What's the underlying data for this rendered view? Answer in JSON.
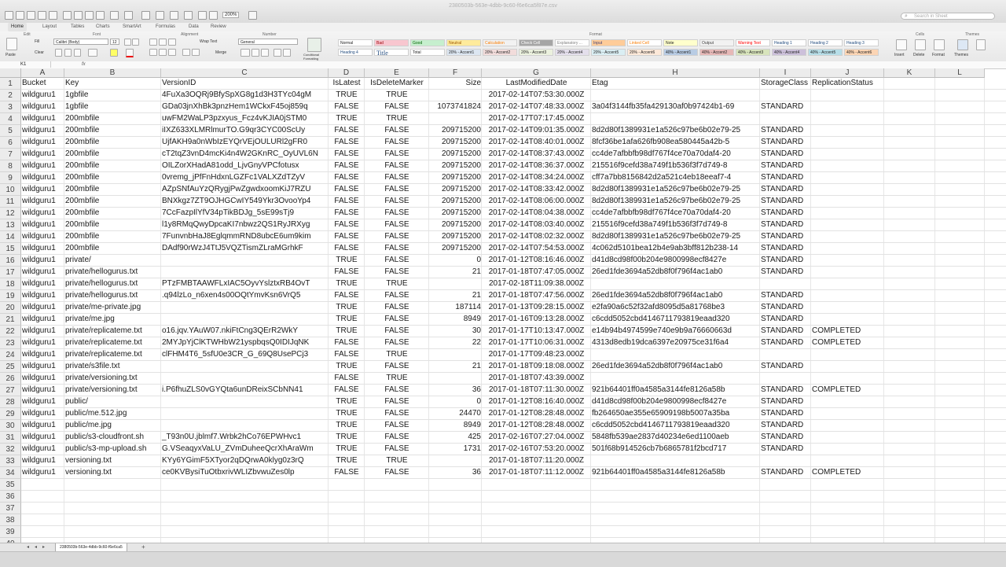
{
  "window": {
    "title": "2380503b-563e-4dbb-9c60-f6e6ca5f87e.csv",
    "zoom": "200%",
    "search_placeholder": "Search in Sheet"
  },
  "ribbon": {
    "tabs": [
      "Home",
      "Layout",
      "Tables",
      "Charts",
      "SmartArt",
      "Formulas",
      "Data",
      "Review"
    ],
    "groups": {
      "edit": "Edit",
      "font": "Font",
      "alignment": "Alignment",
      "number": "Number",
      "format": "Format",
      "cells": "Cells",
      "themes": "Themes"
    },
    "paste": "Paste",
    "fill": "Fill",
    "clear": "Clear",
    "font_name": "Calibri (Body)",
    "font_size": "12",
    "wrap_text": "Wrap Text",
    "merge": "Merge",
    "number_format": "General",
    "conditional": "Conditional Formatting",
    "insert": "Insert",
    "delete": "Delete",
    "format_btn": "Format",
    "themes_btn": "Themes",
    "styles": [
      {
        "label": "Normal",
        "bg": "#ffffff",
        "fg": "#222"
      },
      {
        "label": "Bad",
        "bg": "#f8c6cf",
        "fg": "#9c0006"
      },
      {
        "label": "Good",
        "bg": "#c6efce",
        "fg": "#006100"
      },
      {
        "label": "Neutral",
        "bg": "#ffeb9c",
        "fg": "#9c5700"
      },
      {
        "label": "Calculation",
        "bg": "#f2f2f2",
        "fg": "#fa7d00"
      },
      {
        "label": "Check Cell",
        "bg": "#a5a5a5",
        "fg": "#ffffff"
      },
      {
        "label": "Explanatory ...",
        "bg": "#ffffff",
        "fg": "#7f7f7f"
      },
      {
        "label": "Input",
        "bg": "#ffcc99",
        "fg": "#3f3f76"
      },
      {
        "label": "Linked Cell",
        "bg": "#ffffff",
        "fg": "#fa7d00"
      },
      {
        "label": "Note",
        "bg": "#ffffcc",
        "fg": "#222"
      },
      {
        "label": "Output",
        "bg": "#f2f2f2",
        "fg": "#3f3f3f"
      },
      {
        "label": "Warning Text",
        "bg": "#ffffff",
        "fg": "#ff0000"
      },
      {
        "label": "Heading 1",
        "bg": "#ffffff",
        "fg": "#1f497d"
      },
      {
        "label": "Heading 2",
        "bg": "#ffffff",
        "fg": "#1f497d"
      },
      {
        "label": "Heading 3",
        "bg": "#ffffff",
        "fg": "#1f497d"
      },
      {
        "label": "Heading 4",
        "bg": "#ffffff",
        "fg": "#1f497d"
      },
      {
        "label": "Title",
        "bg": "#ffffff",
        "fg": "#1f497d"
      },
      {
        "label": "Total",
        "bg": "#ffffff",
        "fg": "#222"
      },
      {
        "label": "20% - Accent1",
        "bg": "#dce6f1",
        "fg": "#222"
      },
      {
        "label": "20% - Accent2",
        "bg": "#f2dcdb",
        "fg": "#222"
      },
      {
        "label": "20% - Accent3",
        "bg": "#ebf1de",
        "fg": "#222"
      },
      {
        "label": "20% - Accent4",
        "bg": "#e4dfec",
        "fg": "#222"
      },
      {
        "label": "20% - Accent5",
        "bg": "#daeef3",
        "fg": "#222"
      },
      {
        "label": "20% - Accent6",
        "bg": "#fde9d9",
        "fg": "#222"
      },
      {
        "label": "40% - Accent1",
        "bg": "#b8cce4",
        "fg": "#222"
      },
      {
        "label": "40% - Accent2",
        "bg": "#e6b8b7",
        "fg": "#222"
      },
      {
        "label": "40% - Accent3",
        "bg": "#d8e4bc",
        "fg": "#222"
      },
      {
        "label": "40% - Accent4",
        "bg": "#ccc0da",
        "fg": "#222"
      },
      {
        "label": "40% - Accent5",
        "bg": "#b7dee8",
        "fg": "#222"
      },
      {
        "label": "40% - Accent6",
        "bg": "#fcd5b4",
        "fg": "#222"
      }
    ]
  },
  "formula_bar": {
    "cell_ref": "K1",
    "fx": "fx",
    "value": ""
  },
  "sheet": {
    "columns": [
      "A",
      "B",
      "C",
      "D",
      "E",
      "F",
      "G",
      "H",
      "I",
      "J",
      "K",
      "L"
    ],
    "rows": [
      [
        "Bucket",
        "Key",
        "VersionID",
        "IsLatest",
        "IsDeleteMarker",
        "Size",
        "LastModifiedDate",
        "Etag",
        "StorageClass",
        "ReplicationStatus"
      ],
      [
        "wildguru1",
        "1gbfile",
        "4FuXa3OQRj9BfySpXG8g1d3H3TYc04gM",
        "TRUE",
        "TRUE",
        "",
        "2017-02-14T07:53:30.000Z",
        "",
        "",
        ""
      ],
      [
        "wildguru1",
        "1gbfile",
        "GDa03jnXhBk3pnzHem1WCkxF45oj859q",
        "FALSE",
        "FALSE",
        "1073741824",
        "2017-02-14T07:48:33.000Z",
        "3a04f3144fb35fa429130af0b97424b1-69",
        "STANDARD",
        ""
      ],
      [
        "wildguru1",
        "200mbfile",
        "uwFM2WaLP3pzxyus_Fcz4vKJIA0jSTM0",
        "TRUE",
        "TRUE",
        "",
        "2017-02-17T07:17:45.000Z",
        "",
        "",
        ""
      ],
      [
        "wildguru1",
        "200mbfile",
        "iIXZ633XLMRlmurTO.G9qr3CYC00ScUy",
        "FALSE",
        "FALSE",
        "209715200",
        "2017-02-14T09:01:35.000Z",
        "8d2d80f1389931e1a526c97be6b02e79-25",
        "STANDARD",
        ""
      ],
      [
        "wildguru1",
        "200mbfile",
        "UjfAKH9a0nWbIzEYQrVEjOULURl2gFR0",
        "FALSE",
        "FALSE",
        "209715200",
        "2017-02-14T08:40:01.000Z",
        "8fcf36be1afa626fb908ea580445a42b-5",
        "STANDARD",
        ""
      ],
      [
        "wildguru1",
        "200mbfile",
        "cT2tqZ3vnD4mcKi4n4W2GKnRC_OyUVL6N",
        "FALSE",
        "FALSE",
        "209715200",
        "2017-02-14T08:37:43.000Z",
        "cc4de7afbbfb98df767f4ce70a70daf4-20",
        "STANDARD",
        ""
      ],
      [
        "wildguru1",
        "200mbfile",
        "OILZorXHadA81odd_LjvGnyVPCfotusx",
        "FALSE",
        "FALSE",
        "209715200",
        "2017-02-14T08:36:37.000Z",
        "215516f9cefd38a749f1b536f3f7d749-8",
        "STANDARD",
        ""
      ],
      [
        "wildguru1",
        "200mbfile",
        "0vremg_jPfFnHdxnLGZFc1VALXZdTZyV",
        "FALSE",
        "FALSE",
        "209715200",
        "2017-02-14T08:34:24.000Z",
        "cff7a7bb8156842d2a521c4eb18eeaf7-4",
        "STANDARD",
        ""
      ],
      [
        "wildguru1",
        "200mbfile",
        "AZpSNfAuYzQRygjPwZgwdxoomKiJ7RZU",
        "FALSE",
        "FALSE",
        "209715200",
        "2017-02-14T08:33:42.000Z",
        "8d2d80f1389931e1a526c97be6b02e79-25",
        "STANDARD",
        ""
      ],
      [
        "wildguru1",
        "200mbfile",
        "BNXkgz7ZT9OJHGCwIY549Ykr3OvooYp4",
        "FALSE",
        "FALSE",
        "209715200",
        "2017-02-14T08:06:00.000Z",
        "8d2d80f1389931e1a526c97be6b02e79-25",
        "STANDARD",
        ""
      ],
      [
        "wildguru1",
        "200mbfile",
        "7CcFazpIlYfV34pTikBDJg_5sE99sTj9",
        "FALSE",
        "FALSE",
        "209715200",
        "2017-02-14T08:04:38.000Z",
        "cc4de7afbbfb98df767f4ce70a70daf4-20",
        "STANDARD",
        ""
      ],
      [
        "wildguru1",
        "200mbfile",
        "l1y8RMqQwyDpcaKI7nbwz2QS1RyJRXyg",
        "FALSE",
        "FALSE",
        "209715200",
        "2017-02-14T08:03:40.000Z",
        "215516f9cefd38a749f1b536f3f7d749-8",
        "STANDARD",
        ""
      ],
      [
        "wildguru1",
        "200mbfile",
        "7FunvnbHaJ8EglqmmRND8ubcE6um9kim",
        "FALSE",
        "FALSE",
        "209715200",
        "2017-02-14T08:02:32.000Z",
        "8d2d80f1389931e1a526c97be6b02e79-25",
        "STANDARD",
        ""
      ],
      [
        "wildguru1",
        "200mbfile",
        "DAdf90rWzJ4TtJ5VQZTismZLraMGrhkF",
        "FALSE",
        "FALSE",
        "209715200",
        "2017-02-14T07:54:53.000Z",
        "4c062d5101bea12b4e9ab3bff812b238-14",
        "STANDARD",
        ""
      ],
      [
        "wildguru1",
        "private/",
        "",
        "TRUE",
        "FALSE",
        "0",
        "2017-01-12T08:16:46.000Z",
        "d41d8cd98f00b204e9800998ecf8427e",
        "STANDARD",
        ""
      ],
      [
        "wildguru1",
        "private/hellogurus.txt",
        "",
        "FALSE",
        "FALSE",
        "21",
        "2017-01-18T07:47:05.000Z",
        "26ed1fde3694a52db8f0f796f4ac1ab0",
        "STANDARD",
        ""
      ],
      [
        "wildguru1",
        "private/hellogurus.txt",
        "PTzFMBTAAWFLxIAC5OyvYslztxRB4OvT",
        "TRUE",
        "TRUE",
        "",
        "2017-02-18T11:09:38.000Z",
        "",
        "",
        ""
      ],
      [
        "wildguru1",
        "private/hellogurus.txt",
        ".q94lzLo_n6xen4s00OQtYmvKsn6VrQ5",
        "FALSE",
        "FALSE",
        "21",
        "2017-01-18T07:47:56.000Z",
        "26ed1fde3694a52db8f0f796f4ac1ab0",
        "STANDARD",
        ""
      ],
      [
        "wildguru1",
        "private/me-private.jpg",
        "",
        "TRUE",
        "FALSE",
        "187114",
        "2017-01-13T09:28:15.000Z",
        "e2fa90a6c52f32afd8095d5a81768be3",
        "STANDARD",
        ""
      ],
      [
        "wildguru1",
        "private/me.jpg",
        "",
        "TRUE",
        "FALSE",
        "8949",
        "2017-01-16T09:13:28.000Z",
        "c6cdd5052cbd4146711793819eaad320",
        "STANDARD",
        ""
      ],
      [
        "wildguru1",
        "private/replicateme.txt",
        "o16.jqv.YAuW07.nkiFtCng3QErR2WkY",
        "TRUE",
        "FALSE",
        "30",
        "2017-01-17T10:13:47.000Z",
        "e14b94b4974599e740e9b9a76660663d",
        "STANDARD",
        "COMPLETED"
      ],
      [
        "wildguru1",
        "private/replicateme.txt",
        "2MYJpYjClKTWHbW21yspbqsQ0IDIJqNK",
        "FALSE",
        "FALSE",
        "22",
        "2017-01-17T10:06:31.000Z",
        "4313d8edb19dca6397e20975ce31f6a4",
        "STANDARD",
        "COMPLETED"
      ],
      [
        "wildguru1",
        "private/replicateme.txt",
        "clFHM4T6_5sfU0e3CR_G_69Q8UsePCj3",
        "FALSE",
        "TRUE",
        "",
        "2017-01-17T09:48:23.000Z",
        "",
        "",
        ""
      ],
      [
        "wildguru1",
        "private/s3file.txt",
        "",
        "TRUE",
        "FALSE",
        "21",
        "2017-01-18T09:18:08.000Z",
        "26ed1fde3694a52db8f0f796f4ac1ab0",
        "STANDARD",
        ""
      ],
      [
        "wildguru1",
        "private/versioning.txt",
        "",
        "FALSE",
        "TRUE",
        "",
        "2017-01-18T07:43:39.000Z",
        "",
        "",
        ""
      ],
      [
        "wildguru1",
        "private/versioning.txt",
        "i.P6fhuZLS0vGYQta6unDReixSCbNN41",
        "FALSE",
        "FALSE",
        "36",
        "2017-01-18T07:11:30.000Z",
        "921b64401ff0a4585a3144fe8126a58b",
        "STANDARD",
        "COMPLETED"
      ],
      [
        "wildguru1",
        "public/",
        "",
        "TRUE",
        "FALSE",
        "0",
        "2017-01-12T08:16:40.000Z",
        "d41d8cd98f00b204e9800998ecf8427e",
        "STANDARD",
        ""
      ],
      [
        "wildguru1",
        "public/me.512.jpg",
        "",
        "TRUE",
        "FALSE",
        "24470",
        "2017-01-12T08:28:48.000Z",
        "fb264650ae355e65909198b5007a35ba",
        "STANDARD",
        ""
      ],
      [
        "wildguru1",
        "public/me.jpg",
        "",
        "TRUE",
        "FALSE",
        "8949",
        "2017-01-12T08:28:48.000Z",
        "c6cdd5052cbd4146711793819eaad320",
        "STANDARD",
        ""
      ],
      [
        "wildguru1",
        "public/s3-cloudfront.sh",
        "_T93n0U.jblmf7.Wrbk2hCo76EPWHvc1",
        "TRUE",
        "FALSE",
        "425",
        "2017-02-16T07:27:04.000Z",
        "5848fb539ae2837d40234e6ed1100aeb",
        "STANDARD",
        ""
      ],
      [
        "wildguru1",
        "public/s3-mp-upload.sh",
        "G.VSeaqyxVaLU_ZVmDuheeQcrXhAraWm",
        "TRUE",
        "FALSE",
        "1731",
        "2017-02-16T07:53:20.000Z",
        "501f68b914526cb7b6865781f2bcd717",
        "STANDARD",
        ""
      ],
      [
        "wildguru1",
        "versioning.txt",
        "KYy6YGimF5XTyor2qDQrwA0klyg0z3rQ",
        "TRUE",
        "TRUE",
        "",
        "2017-01-18T07:11:20.000Z",
        "",
        "",
        ""
      ],
      [
        "wildguru1",
        "versioning.txt",
        "ce0KVBysiTuOtbxrivWLIZbvwuZes0lp",
        "FALSE",
        "FALSE",
        "36",
        "2017-01-18T07:11:12.000Z",
        "921b64401ff0a4585a3144fe8126a58b",
        "STANDARD",
        "COMPLETED"
      ],
      [
        "",
        "",
        "",
        "",
        "",
        "",
        "",
        "",
        "",
        ""
      ],
      [
        "",
        "",
        "",
        "",
        "",
        "",
        "",
        "",
        "",
        ""
      ],
      [
        "",
        "",
        "",
        "",
        "",
        "",
        "",
        "",
        "",
        ""
      ],
      [
        "",
        "",
        "",
        "",
        "",
        "",
        "",
        "",
        "",
        ""
      ],
      [
        "",
        "",
        "",
        "",
        "",
        "",
        "",
        "",
        "",
        ""
      ],
      [
        "",
        "",
        "",
        "",
        "",
        "",
        "",
        "",
        "",
        ""
      ]
    ],
    "row_numbers": [
      "1",
      "2",
      "3",
      "4",
      "5",
      "6",
      "7",
      "8",
      "9",
      "10",
      "11",
      "12",
      "13",
      "14",
      "15",
      "16",
      "17",
      "18",
      "19",
      "20",
      "21",
      "22",
      "23",
      "24",
      "25",
      "26",
      "27",
      "28",
      "29",
      "30",
      "31",
      "32",
      "33",
      "34",
      "35",
      "36",
      "37",
      "38",
      "39",
      "40"
    ],
    "tab_name": "2380503b-563e-4dbb-9c60-f6e6ca5"
  }
}
